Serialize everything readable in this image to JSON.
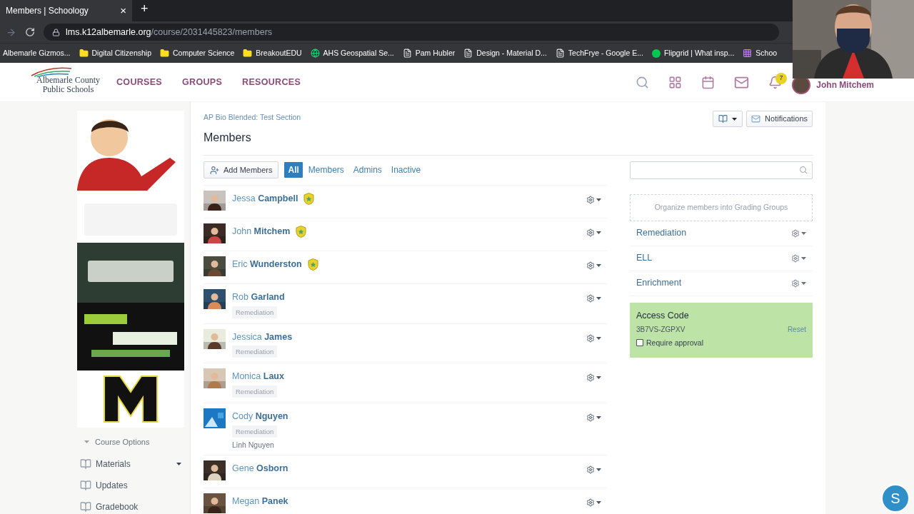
{
  "browser": {
    "tab": {
      "title": "Members | Schoology",
      "close": "×"
    },
    "new_tab": "+",
    "url": {
      "host": "lms.k12albemarle.org",
      "path": "/course/2031445823/members"
    },
    "bookmarks": [
      {
        "label": "Albemarle Gizmos...",
        "kind": "none"
      },
      {
        "label": "Digital Citizenship",
        "kind": "folder"
      },
      {
        "label": "Computer Science",
        "kind": "folder"
      },
      {
        "label": "BreakoutEDU",
        "kind": "folder"
      },
      {
        "label": "AHS Geospatial Se...",
        "kind": "globe"
      },
      {
        "label": "Pam Hubler",
        "kind": "page"
      },
      {
        "label": "Design - Material D...",
        "kind": "page"
      },
      {
        "label": "TechFrye - Google E...",
        "kind": "page"
      },
      {
        "label": "Flipgrid | What insp...",
        "kind": "dot"
      },
      {
        "label": "Schoo",
        "kind": "grid"
      }
    ]
  },
  "header": {
    "logo": {
      "line1": "Albemarle County",
      "line2": "Public Schools"
    },
    "nav": [
      "COURSES",
      "GROUPS",
      "RESOURCES"
    ],
    "notification_count": "7",
    "user": "John Mitchem"
  },
  "sidebar": {
    "course_options": "Course Options",
    "items": [
      {
        "label": "Materials",
        "has_menu": true
      },
      {
        "label": "Updates",
        "has_menu": false
      },
      {
        "label": "Gradebook",
        "has_menu": false
      }
    ]
  },
  "page": {
    "breadcrumb": "AP Bio Blended: Test Section",
    "title": "Members",
    "notifications_button": "Notifications",
    "add_members": "Add Members",
    "filters": [
      {
        "label": "All",
        "selected": true
      },
      {
        "label": "Members",
        "selected": false
      },
      {
        "label": "Admins",
        "selected": false
      },
      {
        "label": "Inactive",
        "selected": false
      }
    ]
  },
  "members": [
    {
      "name": "Jessa **Campbell**",
      "admin": true
    },
    {
      "name": "John **Mitchem**",
      "admin": true
    },
    {
      "name": "Eric **Wunderston**",
      "admin": true
    },
    {
      "name": "Rob **Garland**",
      "admin": false,
      "tag": "Remediation"
    },
    {
      "name": "Jessica **James**",
      "admin": false,
      "tag": "Remediation"
    },
    {
      "name": "Monica **Laux**",
      "admin": false,
      "tag": "Remediation"
    },
    {
      "name": "Cody **Nguyen**",
      "admin": false,
      "tag": "Remediation",
      "parent": "Linh Nguyen"
    },
    {
      "name": "Gene **Osborn**",
      "admin": false
    },
    {
      "name": "Megan **Panek**",
      "admin": false
    }
  ],
  "grading_groups": {
    "prompt": "Organize members into Grading Groups",
    "groups": [
      "Remediation",
      "ELL",
      "Enrichment"
    ]
  },
  "access_code": {
    "title": "Access Code",
    "code": "3B7VS-ZGPXV",
    "reset": "Reset",
    "require_approval": {
      "label": "Require approval",
      "checked": false
    }
  },
  "chat_button": "S"
}
